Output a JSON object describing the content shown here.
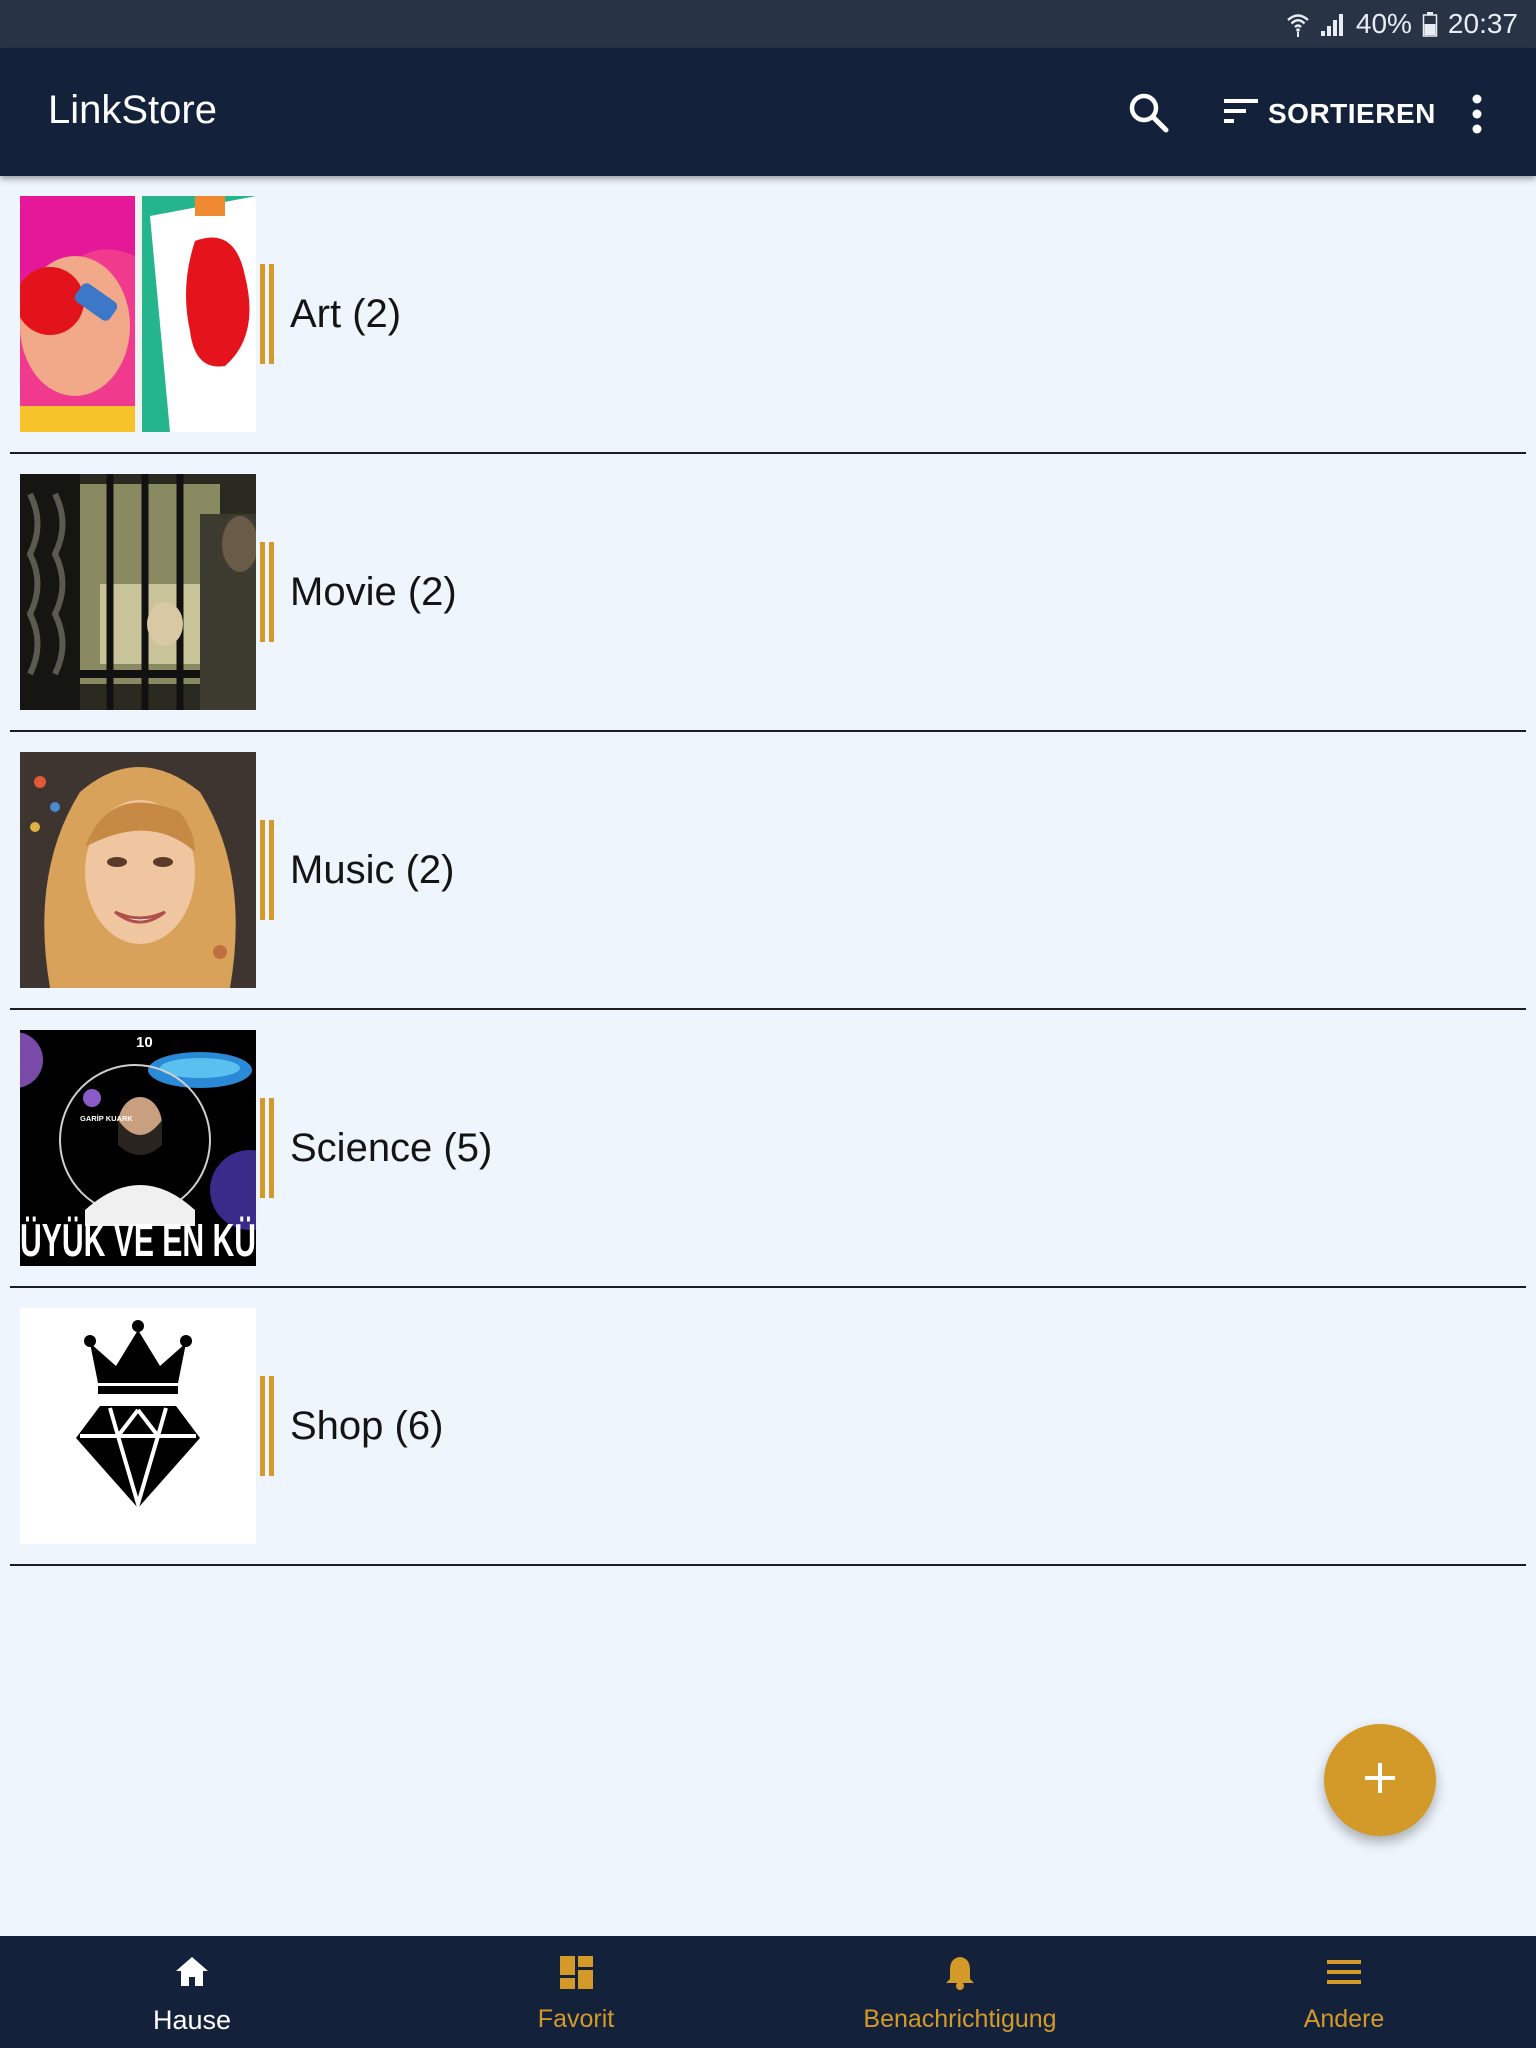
{
  "status_bar": {
    "battery": "40%",
    "time": "20:37",
    "icons": [
      "wifi-icon",
      "signal-icon",
      "battery-icon"
    ]
  },
  "app_bar": {
    "title": "LinkStore",
    "sort_label": "SORTIEREN",
    "icons": [
      "search-icon",
      "sort-icon",
      "more-vert-icon"
    ]
  },
  "categories": [
    {
      "label": "Art (2)",
      "thumbnail": "paint-art-thumbnail"
    },
    {
      "label": "Movie (2)",
      "thumbnail": "movie-scene-thumbnail"
    },
    {
      "label": "Music (2)",
      "thumbnail": "singer-portrait-thumbnail"
    },
    {
      "label": "Science (5)",
      "thumbnail": "science-video-thumbnail",
      "thumbnail_text": "10",
      "thumbnail_small_text": "GARİP KUARK",
      "thumbnail_caption": "ÜYÜK VE EN KÜ"
    },
    {
      "label": "Shop (6)",
      "thumbnail": "crown-diamond-logo"
    }
  ],
  "fab": {
    "icon": "plus-icon"
  },
  "bottom_nav": [
    {
      "label": "Hause",
      "icon": "home-icon",
      "active": true
    },
    {
      "label": "Favorit",
      "icon": "dashboard-icon",
      "active": false
    },
    {
      "label": "Benachrichtigung",
      "icon": "bell-icon",
      "active": false
    },
    {
      "label": "Andere",
      "icon": "menu-icon",
      "active": false
    }
  ],
  "colors": {
    "status_bar": "#283445",
    "app_bar": "#13213a",
    "background": "#eef5fc",
    "accent": "#d39a2a",
    "divider": "#1d1d1d"
  }
}
